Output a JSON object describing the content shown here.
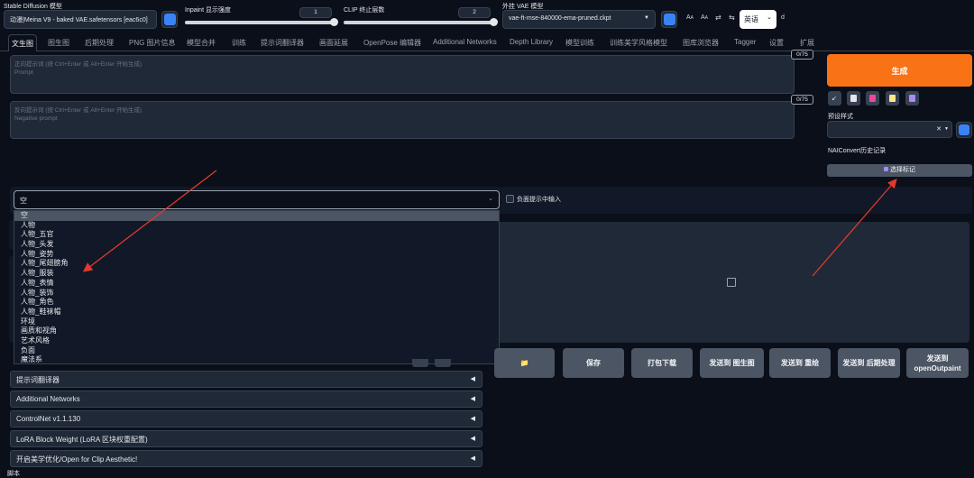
{
  "header": {
    "model_label": "Stable Diffusion 模型",
    "model_value": "动漫|Meina V9 - baked VAE.safetensors [eac6c0]",
    "inpaint_label": "Inpaint 显示强度",
    "inpaint_value": "1",
    "inpaint_fraction": 1.0,
    "clip_label": "CLIP 终止层数",
    "clip_value": "2",
    "clip_fraction": 0.98,
    "vae_label": "外挂 VAE 模型",
    "vae_value": "vae-ft-mse-840000-ema-pruned.ckpt",
    "lang_value": "英语",
    "trailing_char": "d"
  },
  "tabs": [
    "文生图",
    "图生图",
    "后期处理",
    "PNG 图片信息",
    "模型合并",
    "训练",
    "提示词翻译器",
    "画面延展",
    "OpenPose 编辑器",
    "Additional Networks",
    "Depth Library",
    "模型训练",
    "训练美学风格模型",
    "图库浏览器",
    "Tagger",
    "设置",
    "扩展"
  ],
  "prompt": {
    "placeholder_line1": "正向提示词 (按 Ctrl+Enter 或 Alt+Enter 开始生成)",
    "placeholder_line2": "Prompt",
    "counter": "0/75"
  },
  "negative_prompt": {
    "placeholder_line1": "反向提示词 (按 Ctrl+Enter 或 Alt+Enter 开始生成)",
    "placeholder_line2": "Negative prompt",
    "counter": "0/75"
  },
  "sidebar": {
    "generate_label": "生成",
    "preset_label": "预设样式",
    "history_label": "NAIConvert历史记录",
    "choose_tags_label": "选择标记"
  },
  "dropdown": {
    "selected": "空",
    "negative_checkbox_label": "负面提示中输入",
    "options": [
      "空",
      "人物",
      "人物_五官",
      "人物_头发",
      "人物_姿势",
      "人物_尾翅膀角",
      "人物_服装",
      "人物_表情",
      "人物_装饰",
      "人物_角色",
      "人物_鞋袜帽",
      "环境",
      "画质和视角",
      "艺术风格",
      "负面",
      "魔法系"
    ]
  },
  "accordions": [
    "提示词翻译器",
    "Additional Networks",
    "ControlNet v1.1.130",
    "LoRA Block Weight (LoRA 区块权重配置)",
    "开启美学优化/Open for Clip Aesthetic!"
  ],
  "footer_label": "脚本",
  "actions": {
    "folder_icon": "📁",
    "save": "保存",
    "zip": "打包下载",
    "send_img2img": "发送到 图生图",
    "send_inpaint": "发送到 重绘",
    "send_extras": "发送到 后期处理",
    "send_openoutpaint": "发送到 openOutpaint"
  },
  "colors": {
    "accent": "#f97316",
    "annotation_arrow": "#e03a2e",
    "info_icon": "#3b82f6"
  }
}
